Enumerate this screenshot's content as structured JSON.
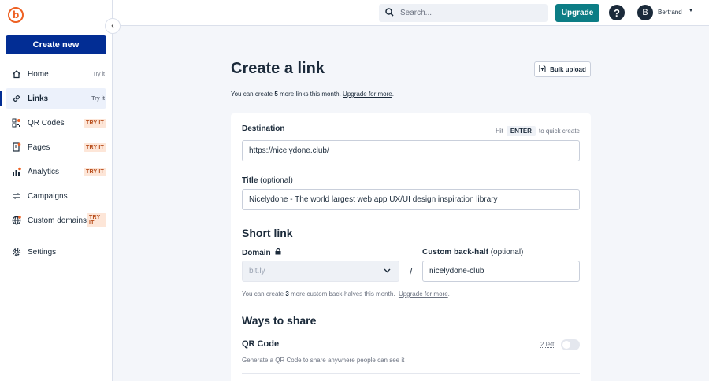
{
  "brand": {
    "logo_letter": "b",
    "accent": "#ee6123",
    "primary": "#022d94"
  },
  "sidebar": {
    "create_label": "Create new",
    "items": [
      {
        "label": "Home",
        "badge": "Try it",
        "badge_style": "plain",
        "icon": "home-icon"
      },
      {
        "label": "Links",
        "badge": "Try it",
        "badge_style": "plain",
        "icon": "link-icon",
        "active": true
      },
      {
        "label": "QR Codes",
        "badge": "TRY IT",
        "badge_style": "orange",
        "icon": "qr-code-icon"
      },
      {
        "label": "Pages",
        "badge": "TRY IT",
        "badge_style": "orange",
        "icon": "pages-icon"
      },
      {
        "label": "Analytics",
        "badge": "TRY IT",
        "badge_style": "orange",
        "icon": "analytics-icon"
      },
      {
        "label": "Campaigns",
        "badge": "",
        "icon": "campaigns-icon"
      },
      {
        "label": "Custom domains",
        "badge": "TRY IT",
        "badge_style": "orange",
        "icon": "globe-icon"
      },
      {
        "label": "Settings",
        "badge": "",
        "icon": "gear-icon"
      }
    ]
  },
  "header": {
    "search_placeholder": "Search...",
    "upgrade_label": "Upgrade",
    "avatar_letter": "B",
    "user_name": "Bertrand"
  },
  "main": {
    "title": "Create a link",
    "bulk_label": "Bulk upload",
    "limit": {
      "prefix": "You can create",
      "count": "5",
      "suffix": "more links this month.",
      "link": "Upgrade for more",
      "end": "."
    },
    "destination": {
      "label": "Destination",
      "hint_prefix": "Hit",
      "hint_key": "ENTER",
      "hint_suffix": "to quick create",
      "value": "https://nicelydone.club/"
    },
    "title_field": {
      "label": "Title",
      "optional": "(optional)",
      "value": "Nicelydone - The world largest web app UX/UI design inspiration library"
    },
    "short_link": {
      "heading": "Short link",
      "domain_label": "Domain",
      "domain_value": "bit.ly",
      "separator": "/",
      "backhalf_label": "Custom back-half",
      "backhalf_optional": "(optional)",
      "backhalf_value": "nicelydone-club",
      "limit_prefix": "You can create",
      "limit_count": "3",
      "limit_suffix": "more custom back-halves this month.",
      "limit_link": "Upgrade for more",
      "limit_end": "."
    },
    "share": {
      "heading": "Ways to share",
      "qr_title": "QR Code",
      "qr_left": "2 left",
      "qr_desc": "Generate a QR Code to share anywhere people can see it",
      "qr_enabled": false
    }
  }
}
